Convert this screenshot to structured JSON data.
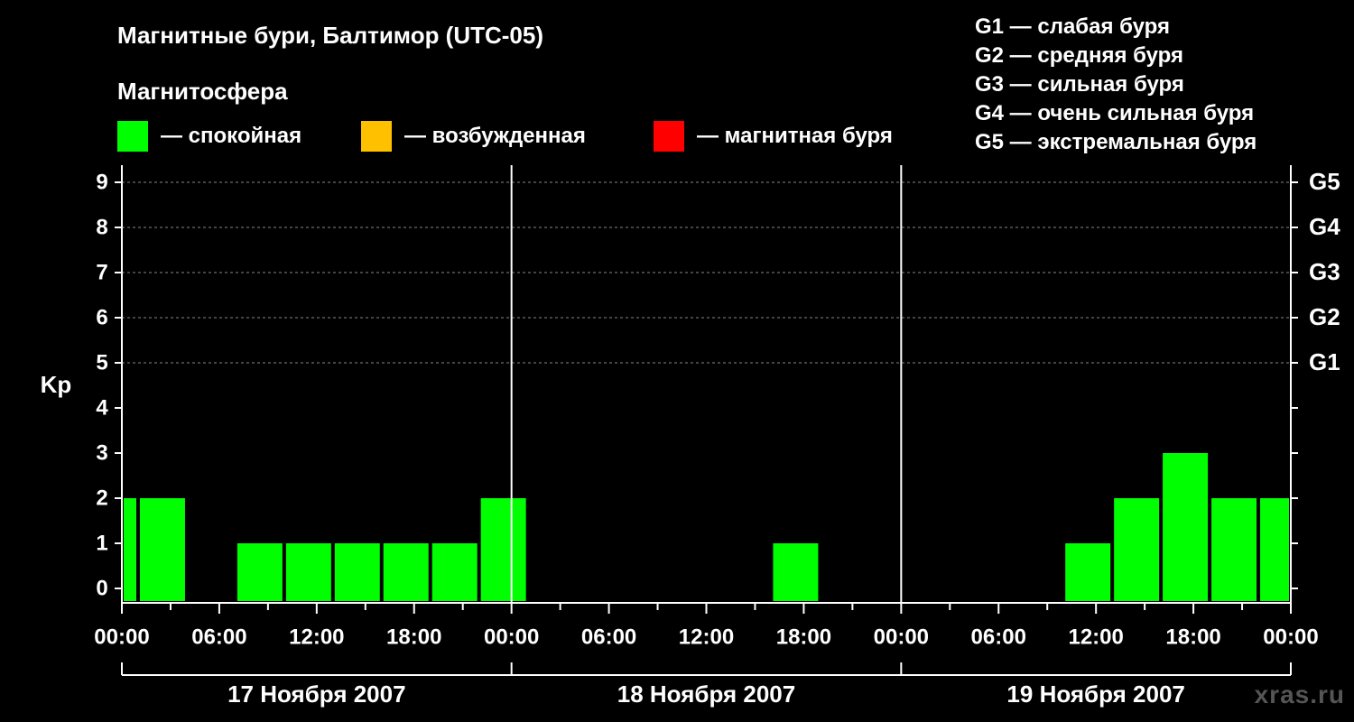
{
  "title": "Магнитные бури, Балтимор (UTC-05)",
  "subtitle": "Магнитосфера",
  "legend": [
    {
      "label": "— спокойная",
      "color": "#00ff00"
    },
    {
      "label": "— возбужденная",
      "color": "#ffc000"
    },
    {
      "label": "— магнитная буря",
      "color": "#ff0000"
    }
  ],
  "g_legend": [
    "G1 — слабая буря",
    "G2 — средняя буря",
    "G3 — сильная буря",
    "G4 — очень сильная буря",
    "G5 — экстремальная буря"
  ],
  "watermark": "xras.ru",
  "chart_data": {
    "type": "bar",
    "ylabel": "Kp",
    "ylim": [
      0,
      9
    ],
    "yticks": [
      "0",
      "1",
      "2",
      "3",
      "4",
      "5",
      "6",
      "7",
      "8",
      "9"
    ],
    "right_ticks": [
      {
        "kp": 5,
        "label": "G1"
      },
      {
        "kp": 6,
        "label": "G2"
      },
      {
        "kp": 7,
        "label": "G3"
      },
      {
        "kp": 8,
        "label": "G4"
      },
      {
        "kp": 9,
        "label": "G5"
      }
    ],
    "x_tick_labels": [
      "00:00",
      "06:00",
      "12:00",
      "18:00",
      "00:00",
      "06:00",
      "12:00",
      "18:00",
      "00:00",
      "06:00",
      "12:00",
      "18:00",
      "00:00"
    ],
    "days": [
      "17 Ноября 2007",
      "18 Ноября 2007",
      "19 Ноября 2007"
    ],
    "grid": true,
    "series": [
      {
        "values": [
          {
            "start": "17 Ноября 2007 00:00",
            "end": "17 Ноября 2007 01:00",
            "kp": 2
          },
          {
            "start": "17 Ноября 2007 01:00",
            "end": "17 Ноября 2007 04:00",
            "kp": 2
          },
          {
            "start": "17 Ноября 2007 04:00",
            "end": "17 Ноября 2007 07:00",
            "kp": 0
          },
          {
            "start": "17 Ноября 2007 07:00",
            "end": "17 Ноября 2007 10:00",
            "kp": 1
          },
          {
            "start": "17 Ноября 2007 10:00",
            "end": "17 Ноября 2007 13:00",
            "kp": 1
          },
          {
            "start": "17 Ноября 2007 13:00",
            "end": "17 Ноября 2007 16:00",
            "kp": 1
          },
          {
            "start": "17 Ноября 2007 16:00",
            "end": "17 Ноября 2007 19:00",
            "kp": 1
          },
          {
            "start": "17 Ноября 2007 19:00",
            "end": "17 Ноября 2007 22:00",
            "kp": 1
          },
          {
            "start": "17 Ноября 2007 22:00",
            "end": "18 Ноября 2007 01:00",
            "kp": 2
          },
          {
            "start": "18 Ноября 2007 16:00",
            "end": "18 Ноября 2007 19:00",
            "kp": 1
          },
          {
            "start": "19 Ноября 2007 10:00",
            "end": "19 Ноября 2007 13:00",
            "kp": 1
          },
          {
            "start": "19 Ноября 2007 13:00",
            "end": "19 Ноября 2007 16:00",
            "kp": 2
          },
          {
            "start": "19 Ноября 2007 16:00",
            "end": "19 Ноября 2007 19:00",
            "kp": 3
          },
          {
            "start": "19 Ноября 2007 19:00",
            "end": "19 Ноября 2007 22:00",
            "kp": 2
          },
          {
            "start": "19 Ноября 2007 22:00",
            "end": "20 Ноября 2007 00:00",
            "kp": 2
          }
        ]
      }
    ]
  }
}
